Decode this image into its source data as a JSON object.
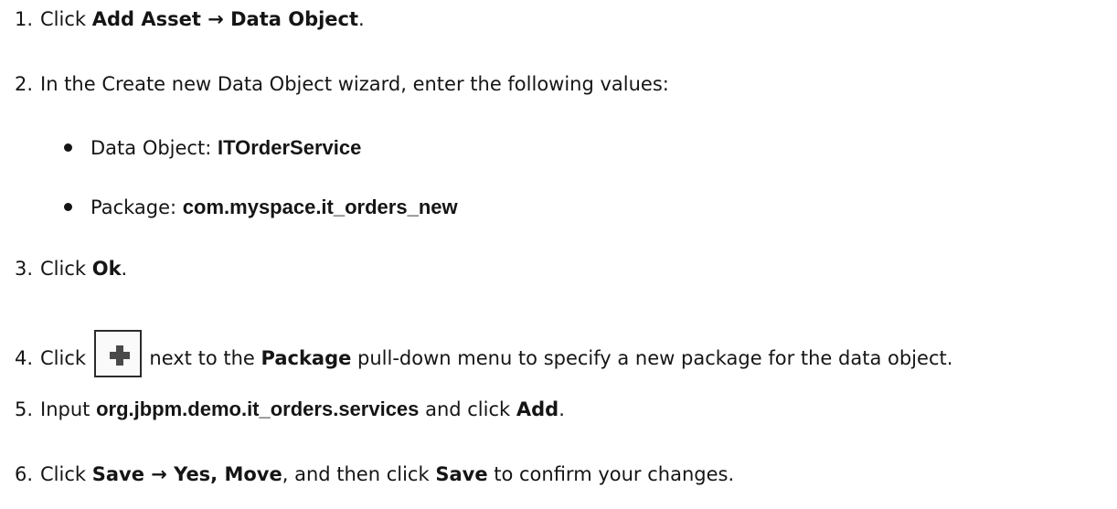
{
  "steps": [
    {
      "num": "1.",
      "pre": "Click ",
      "b1": "Add Asset → Data Object",
      "post": "."
    },
    {
      "num": "2.",
      "text": "In the Create new Data Object wizard, enter the following values:"
    },
    {
      "num": "3.",
      "pre": "Click ",
      "b1": "Ok",
      "post": "."
    },
    {
      "num": "4.",
      "pre": "Click ",
      "mid": " next to the ",
      "b1": "Package",
      "post": " pull-down menu to specify a new package for the data object.",
      "icon": "plus-icon"
    },
    {
      "num": "5.",
      "pre": "Input ",
      "b1": "org.jbpm.demo.it_orders.services",
      "mid": " and click ",
      "b2": "Add",
      "post": "."
    },
    {
      "num": "6.",
      "pre": "Click ",
      "b1": "Save → Yes, Move",
      "mid": ", and then click ",
      "b2": "Save",
      "post": " to confirm your changes."
    }
  ],
  "bullets": [
    {
      "label": "Data Object: ",
      "value": "ITOrderService"
    },
    {
      "label": "Package: ",
      "value": "com.myspace.it_orders_new"
    }
  ]
}
